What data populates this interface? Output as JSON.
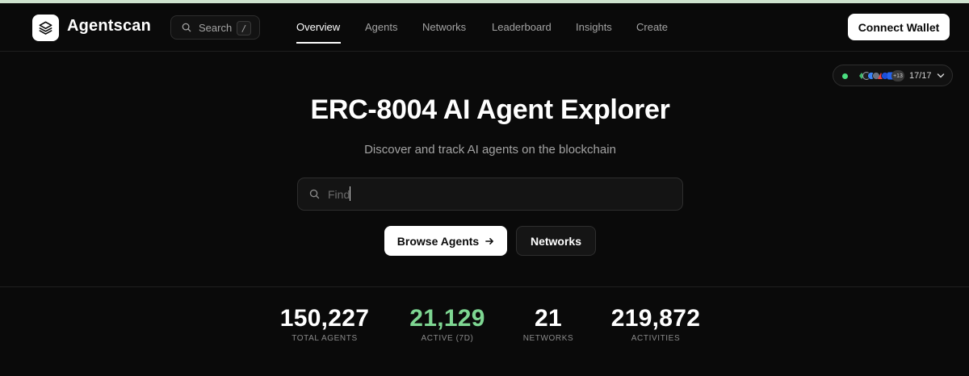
{
  "app": {
    "name": "Agentscan"
  },
  "header": {
    "search_label": "Search",
    "search_shortcut": "/",
    "nav": [
      {
        "label": "Overview",
        "active": true
      },
      {
        "label": "Agents",
        "active": false
      },
      {
        "label": "Networks",
        "active": false
      },
      {
        "label": "Leaderboard",
        "active": false
      },
      {
        "label": "Insights",
        "active": false
      },
      {
        "label": "Create",
        "active": false
      }
    ],
    "connect_label": "Connect Wallet"
  },
  "network_status": {
    "extra_chains": "+13",
    "count": "17/17",
    "status_color": "#4ade80"
  },
  "hero": {
    "title": "ERC-8004 AI Agent Explorer",
    "subtitle": "Discover and track AI agents on the blockchain",
    "search_placeholder": "Find",
    "browse_label": "Browse Agents",
    "networks_label": "Networks"
  },
  "stats": [
    {
      "value": "150,227",
      "label": "TOTAL AGENTS",
      "color": "#ffffff"
    },
    {
      "value": "21,129",
      "label": "ACTIVE (7D)",
      "color": "#7ed692"
    },
    {
      "value": "21",
      "label": "NETWORKS",
      "color": "#ffffff"
    },
    {
      "value": "219,872",
      "label": "ACTIVITIES",
      "color": "#ffffff"
    }
  ]
}
